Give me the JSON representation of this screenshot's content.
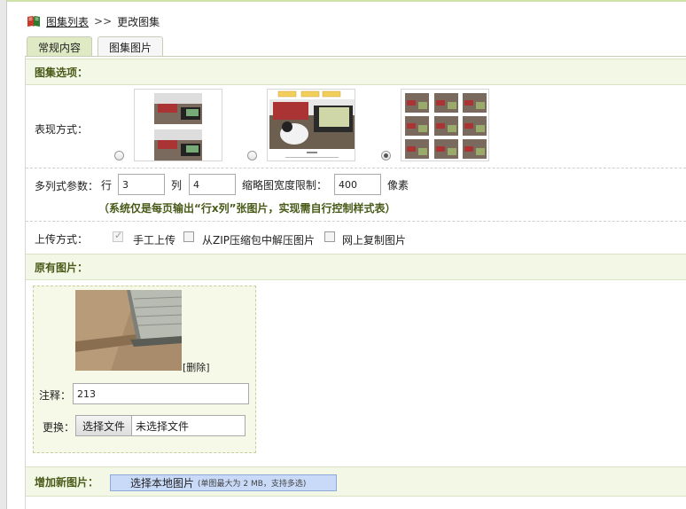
{
  "breadcrumb": {
    "link_label": "图集列表",
    "separator": ">>",
    "current": "更改图集"
  },
  "tabs": [
    {
      "label": "常规内容",
      "active": true
    },
    {
      "label": "图集图片",
      "active": false
    }
  ],
  "options_section": {
    "title": "图集选项：",
    "display_mode_label": "表现方式：",
    "display_modes": [
      {
        "name": "single-column",
        "checked": false
      },
      {
        "name": "slideshow",
        "checked": false
      },
      {
        "name": "multi-column-grid",
        "checked": true
      }
    ],
    "multicol": {
      "label": "多列式参数：",
      "row_label": "行",
      "row_value": "3",
      "col_label": "列",
      "col_value": "4",
      "thumb_width_label": "缩略图宽度限制：",
      "thumb_width_value": "400",
      "unit": "像素",
      "note": "（系统仅是每页输出“行x列”张图片，实现需自行控制样式表）"
    },
    "upload_mode": {
      "label": "上传方式：",
      "options": [
        {
          "label": "手工上传",
          "checked": true
        },
        {
          "label": "从ZIP压缩包中解压图片",
          "checked": false
        },
        {
          "label": "网上复制图片",
          "checked": false
        }
      ]
    }
  },
  "original_section": {
    "title": "原有图片：",
    "delete_label": "[删除]",
    "comment_label": "注释：",
    "comment_value": "213",
    "replace_label": "更换：",
    "file_button": "选择文件",
    "file_status": "未选择文件"
  },
  "new_section": {
    "title": "增加新图片：",
    "upload_button": "选择本地图片",
    "upload_hint": "(单图最大为 2 MB，支持多选)"
  },
  "colors": {
    "section_title": "#4a5a18",
    "section_bg": "#f3f7e6",
    "active_tab": "#dfe9c4",
    "upload_button": "#c8daf8"
  }
}
